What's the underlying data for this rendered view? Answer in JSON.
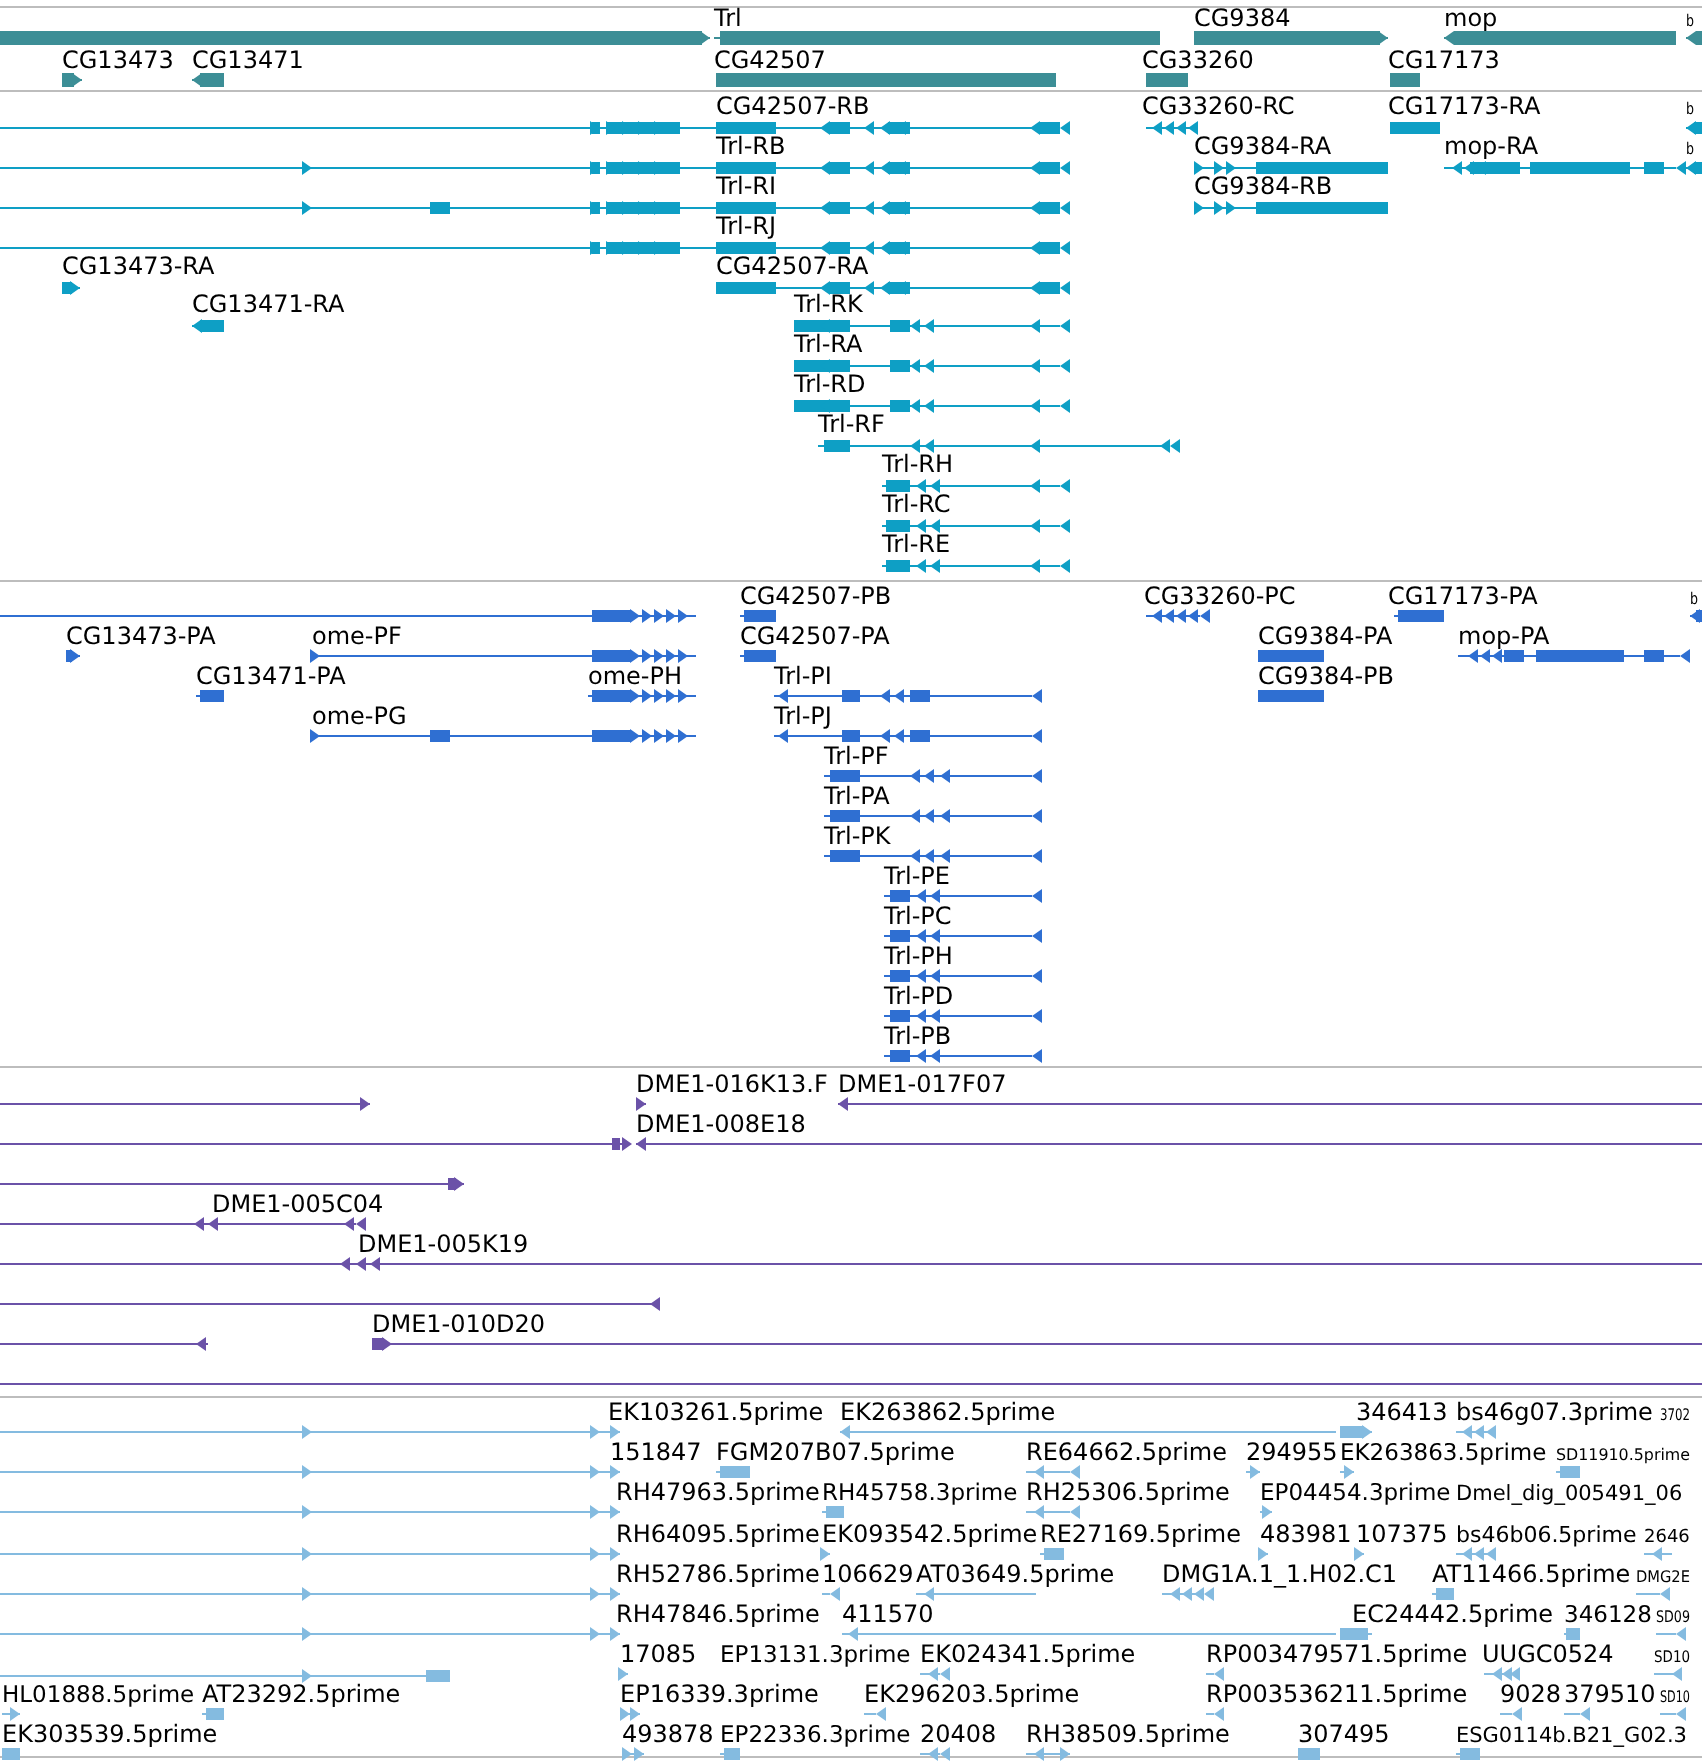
{
  "tracks": [
    {
      "kind": "gene",
      "color": "#3c8e96",
      "features": [
        {
          "label": "Trl"
        },
        {
          "label": "CG9384"
        },
        {
          "label": "mop"
        },
        {
          "label": "b"
        },
        {
          "label": "CG13473"
        },
        {
          "label": "CG13471"
        },
        {
          "label": "CG42507"
        },
        {
          "label": "CG33260"
        },
        {
          "label": "CG17173"
        }
      ]
    },
    {
      "kind": "transcript",
      "color": "#0e9fc5",
      "features": [
        {
          "label": "CG42507-RB"
        },
        {
          "label": "CG33260-RC"
        },
        {
          "label": "CG17173-RA"
        },
        {
          "label": "b"
        },
        {
          "label": "Trl-RB"
        },
        {
          "label": "CG9384-RA"
        },
        {
          "label": "mop-RA"
        },
        {
          "label": "b"
        },
        {
          "label": "Trl-RI"
        },
        {
          "label": "CG9384-RB"
        },
        {
          "label": "Trl-RJ"
        },
        {
          "label": "CG13473-RA"
        },
        {
          "label": "CG42507-RA"
        },
        {
          "label": "CG13471-RA"
        },
        {
          "label": "Trl-RK"
        },
        {
          "label": "Trl-RA"
        },
        {
          "label": "Trl-RD"
        },
        {
          "label": "Trl-RF"
        },
        {
          "label": "Trl-RH"
        },
        {
          "label": "Trl-RC"
        },
        {
          "label": "Trl-RE"
        }
      ]
    },
    {
      "kind": "polypeptide",
      "color": "#2f6fd2",
      "features": [
        {
          "label": "CG42507-PB"
        },
        {
          "label": "CG33260-PC"
        },
        {
          "label": "CG17173-PA"
        },
        {
          "label": "b"
        },
        {
          "label": "CG13473-PA"
        },
        {
          "label": "ome-PF"
        },
        {
          "label": "CG42507-PA"
        },
        {
          "label": "CG9384-PA"
        },
        {
          "label": "mop-PA"
        },
        {
          "label": "CG13471-PA"
        },
        {
          "label": "ome-PH"
        },
        {
          "label": "Trl-PI"
        },
        {
          "label": "CG9384-PB"
        },
        {
          "label": "ome-PG"
        },
        {
          "label": "Trl-PJ"
        },
        {
          "label": "Trl-PF"
        },
        {
          "label": "Trl-PA"
        },
        {
          "label": "Trl-PK"
        },
        {
          "label": "Trl-PE"
        },
        {
          "label": "Trl-PC"
        },
        {
          "label": "Trl-PH"
        },
        {
          "label": "Trl-PD"
        },
        {
          "label": "Trl-PB"
        }
      ]
    },
    {
      "kind": "clone",
      "color": "#6b52a8",
      "features": [
        {
          "label": "DME1-016K13.F"
        },
        {
          "label": "DME1-017F07"
        },
        {
          "label": "DME1-008E18"
        },
        {
          "label": "DME1-005C04"
        },
        {
          "label": "DME1-005K19"
        },
        {
          "label": "DME1-010D20"
        }
      ]
    },
    {
      "kind": "est",
      "color": "#84bbe0",
      "features": [
        {
          "label": "EK103261.5prime"
        },
        {
          "label": "EK263862.5prime"
        },
        {
          "label": "346413"
        },
        {
          "label": "bs46g07.3prime"
        },
        {
          "label": "3702"
        },
        {
          "label": "151847"
        },
        {
          "label": "FGM207B07.5prime"
        },
        {
          "label": "RE64662.5prime"
        },
        {
          "label": "294955"
        },
        {
          "label": "EK263863.5prime"
        },
        {
          "label": "SD11910.5prime"
        },
        {
          "label": "RH47963.5prime"
        },
        {
          "label": "RH45758.3prime"
        },
        {
          "label": "RH25306.5prime"
        },
        {
          "label": "EP04454.3prime"
        },
        {
          "label": "Dmel_dig_005491_06"
        },
        {
          "label": "RH64095.5prime"
        },
        {
          "label": "EK093542.5prime"
        },
        {
          "label": "RE27169.5prime"
        },
        {
          "label": "483981"
        },
        {
          "label": "107375"
        },
        {
          "label": "bs46b06.5prime"
        },
        {
          "label": "2646"
        },
        {
          "label": "RH52786.5prime"
        },
        {
          "label": "106629"
        },
        {
          "label": "AT03649.5prime"
        },
        {
          "label": "DMG1A.1_1.H02.C1"
        },
        {
          "label": "AT11466.5prime"
        },
        {
          "label": "DMG2E"
        },
        {
          "label": "RH47846.5prime"
        },
        {
          "label": "411570"
        },
        {
          "label": "EC24442.5prime"
        },
        {
          "label": "346128"
        },
        {
          "label": "SD09"
        },
        {
          "label": "17085"
        },
        {
          "label": "EP13131.3prime"
        },
        {
          "label": "EK024341.5prime"
        },
        {
          "label": "RP003479571.5prime"
        },
        {
          "label": "UUGC0524"
        },
        {
          "label": "SD10"
        },
        {
          "label": "HL01888.5prime"
        },
        {
          "label": "AT23292.5prime"
        },
        {
          "label": "EP16339.3prime"
        },
        {
          "label": "EK296203.5prime"
        },
        {
          "label": "RP003536211.5prime"
        },
        {
          "label": "9028"
        },
        {
          "label": "379510"
        },
        {
          "label": "SD10"
        },
        {
          "label": "EK303539.5prime"
        },
        {
          "label": "493878"
        },
        {
          "label": "EP22336.3prime"
        },
        {
          "label": "20408"
        },
        {
          "label": "RH38509.5prime"
        },
        {
          "label": "307495"
        },
        {
          "label": "ESG0114b.B21_G02.3"
        }
      ]
    }
  ]
}
